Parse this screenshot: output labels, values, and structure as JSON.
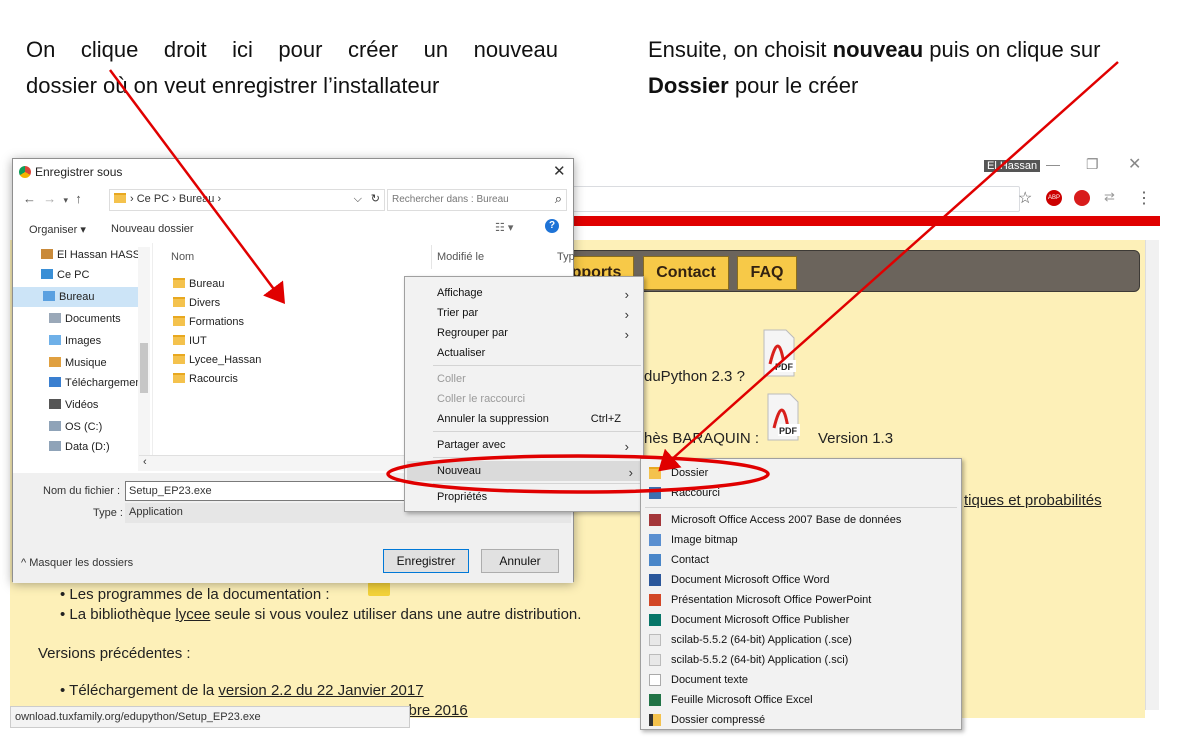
{
  "caption_left": [
    "On clique droit ici pour créer un nouveau",
    "dossier où on veut enregistrer l’installateur"
  ],
  "caption_right": {
    "l1_pre": "Ensuite,  on choisit ",
    "l1_bold": "nouveau",
    "l1_post": " puis on clique sur",
    "l2_bold": "Dossier",
    "l2_post": " pour le créer"
  },
  "browser": {
    "user": "El Hassan",
    "url_status": "ownload.tuxfamily.org/edupython/Setup_EP23.exe",
    "tabs": [
      "pports",
      "Contact",
      "FAQ"
    ],
    "page_lines": {
      "l1": "duPython 2.3 ?",
      "l2a": "hès BARAQUIN :",
      "l2b": "Version 1.3",
      "l3": "tiques et probabilités",
      "b1": "Les programmes de la documentation :",
      "b2_pre": "La bibliothèque ",
      "b2_link": "lycee",
      "b2_post": " seule si vous voulez utiliser dans une autre distribution.",
      "versions": "Versions précédentes :",
      "b3_pre": "Téléchargement de la ",
      "b3_link": "version 2.2 du 22 Janvier 2017",
      "b4_tail": "mbre 2016"
    },
    "pdf_label": "PDF"
  },
  "dialog": {
    "title": "Enregistrer sous",
    "breadcrumb": [
      "Ce PC",
      "Bureau"
    ],
    "search_placeholder": "Rechercher dans : Bureau",
    "organize": "Organiser ▾",
    "new_folder": "Nouveau dossier",
    "nav": [
      "El Hassan HASSI",
      "Ce PC",
      "Bureau",
      "Documents",
      "Images",
      "Musique",
      "Téléchargemen",
      "Vidéos",
      "OS (C:)",
      "Data (D:)"
    ],
    "columns": {
      "name": "Nom",
      "modified": "Modifié le",
      "type": "Typ"
    },
    "files": [
      "Bureau",
      "Divers",
      "Formations",
      "IUT",
      "Lycee_Hassan",
      "Racourcis"
    ],
    "filename_label": "Nom du fichier :",
    "filename_value": "Setup_EP23.exe",
    "type_label": "Type :",
    "type_value": "Application",
    "hide_folders": "Masquer les dossiers",
    "save": "Enregistrer",
    "cancel": "Annuler"
  },
  "context_menu": {
    "items": [
      {
        "label": "Affichage",
        "sub": true
      },
      {
        "label": "Trier par",
        "sub": true
      },
      {
        "label": "Regrouper par",
        "sub": true
      },
      {
        "label": "Actualiser"
      },
      {
        "label": "Coller",
        "disabled": true
      },
      {
        "label": "Coller le raccourci",
        "disabled": true
      },
      {
        "label": "Annuler la suppression",
        "shortcut": "Ctrl+Z"
      },
      {
        "label": "Partager avec",
        "sub": true
      },
      {
        "label": "Nouveau",
        "sub": true
      },
      {
        "label": "Propriétés"
      }
    ]
  },
  "submenu": {
    "items": [
      "Dossier",
      "Raccourci",
      "Microsoft Office Access 2007 Base de données",
      "Image bitmap",
      "Contact",
      "Document Microsoft Office Word",
      "Présentation Microsoft Office PowerPoint",
      "Document Microsoft Office Publisher",
      "scilab-5.5.2 (64-bit) Application (.sce)",
      "scilab-5.5.2 (64-bit) Application (.sci)",
      "Document texte",
      "Feuille Microsoft Office Excel",
      "Dossier compressé"
    ]
  },
  "colors": {
    "annotation": "#e00000",
    "page_bg": "#fdf0b8",
    "tab": "#f7c948",
    "highlight": "#cce4f7"
  }
}
